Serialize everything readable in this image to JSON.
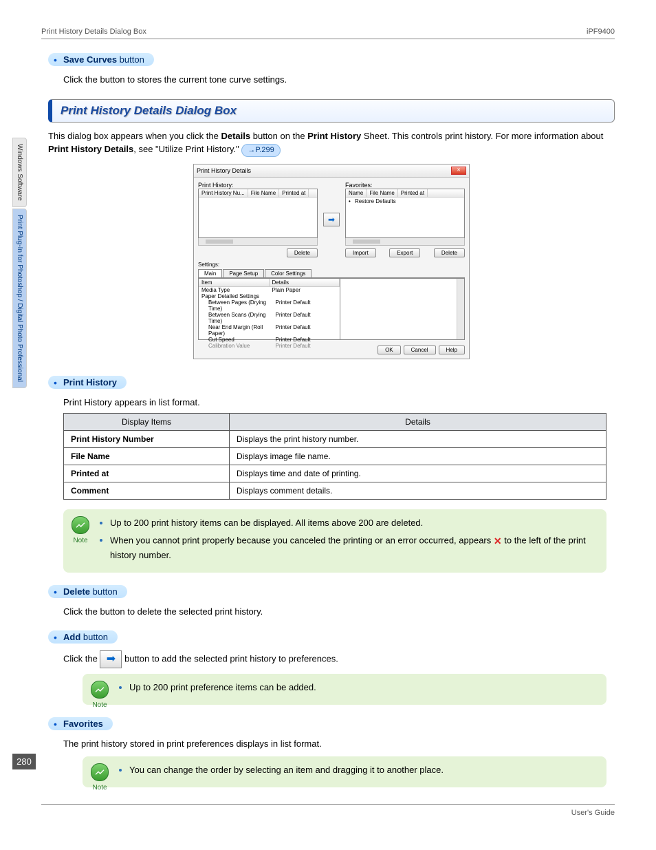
{
  "header": {
    "left": "Print History Details Dialog Box",
    "right": "iPF9400"
  },
  "sideTabs": {
    "t1": "Windows Software",
    "t2": "Print Plug-In for Photoshop / Digital Photo Professional"
  },
  "pageNumber": "280",
  "footer": "User's Guide",
  "saveCurves": {
    "title": "Save Curves",
    "suffix": " button",
    "desc": "Click the button to stores the current tone curve settings."
  },
  "section": {
    "title": "Print History Details Dialog Box"
  },
  "intro": {
    "part1": "This dialog box appears when you click the ",
    "b1": "Details",
    "part2": " button on the ",
    "b2": "Print History",
    "part3": " Sheet. This controls print history. For more information about ",
    "b3": "Print History Details",
    "part4": ", see \"Utilize Print History.\" ",
    "link": "→P.299"
  },
  "dialog": {
    "title": "Print History Details",
    "labels": {
      "printHistory": "Print History:",
      "favorites": "Favorites:",
      "settings": "Settings:"
    },
    "leftCols": {
      "c1": "Print History Nu...",
      "c2": "File Name",
      "c3": "Printed at"
    },
    "rightCols": {
      "c1": "Name",
      "c2": "File Name",
      "c3": "Printed at"
    },
    "rightRow": "Restore Defaults",
    "buttons": {
      "delete": "Delete",
      "import": "Import",
      "export": "Export",
      "ok": "OK",
      "cancel": "Cancel",
      "help": "Help"
    },
    "tabs": {
      "main": "Main",
      "page": "Page Setup",
      "color": "Color Settings"
    },
    "detailsHead": {
      "item": "Item",
      "details": "Details"
    },
    "rows": {
      "r1a": "Media Type",
      "r1b": "Plain Paper",
      "r2a": "Paper Detailed Settings",
      "r2b": "",
      "r3a": "Between Pages (Drying Time)",
      "r3b": "Printer Default",
      "r4a": "Between Scans (Drying Time)",
      "r4b": "Printer Default",
      "r5a": "Near End Margin (Roll Paper)",
      "r5b": "Printer Default",
      "r6a": "Cut Speed",
      "r6b": "Printer Default",
      "r7a": "Calibration Value",
      "r7b": "Printer Default"
    }
  },
  "printHistory": {
    "title": "Print History",
    "desc": "Print History appears in list format.",
    "th1": "Display Items",
    "th2": "Details",
    "rows": {
      "r1a": "Print History Number",
      "r1b": "Displays the print history number.",
      "r2a": "File Name",
      "r2b": "Displays image file name.",
      "r3a": "Printed at",
      "r3b": "Displays time and date of printing.",
      "r4a": "Comment",
      "r4b": "Displays comment details."
    },
    "note": {
      "label": "Note",
      "n1": "Up to 200 print history items can be displayed. All items above 200 are deleted.",
      "n2a": "When you cannot print properly because you canceled the printing or an error occurred, appears ",
      "n2b": " to the left of the print history number."
    }
  },
  "deleteBtn": {
    "title": "Delete",
    "suffix": " button",
    "desc": "Click the button to delete the selected print history."
  },
  "addBtn": {
    "title": "Add",
    "suffix": " button",
    "before": "Click the ",
    "after": " button to add the selected print history to preferences.",
    "note": {
      "label": "Note",
      "n1": "Up to 200 print preference items can be added."
    }
  },
  "favorites": {
    "title": "Favorites",
    "desc": "The print history stored in print preferences displays in list format.",
    "note": {
      "label": "Note",
      "n1": "You can change the order by selecting an item and dragging it to another place."
    }
  }
}
